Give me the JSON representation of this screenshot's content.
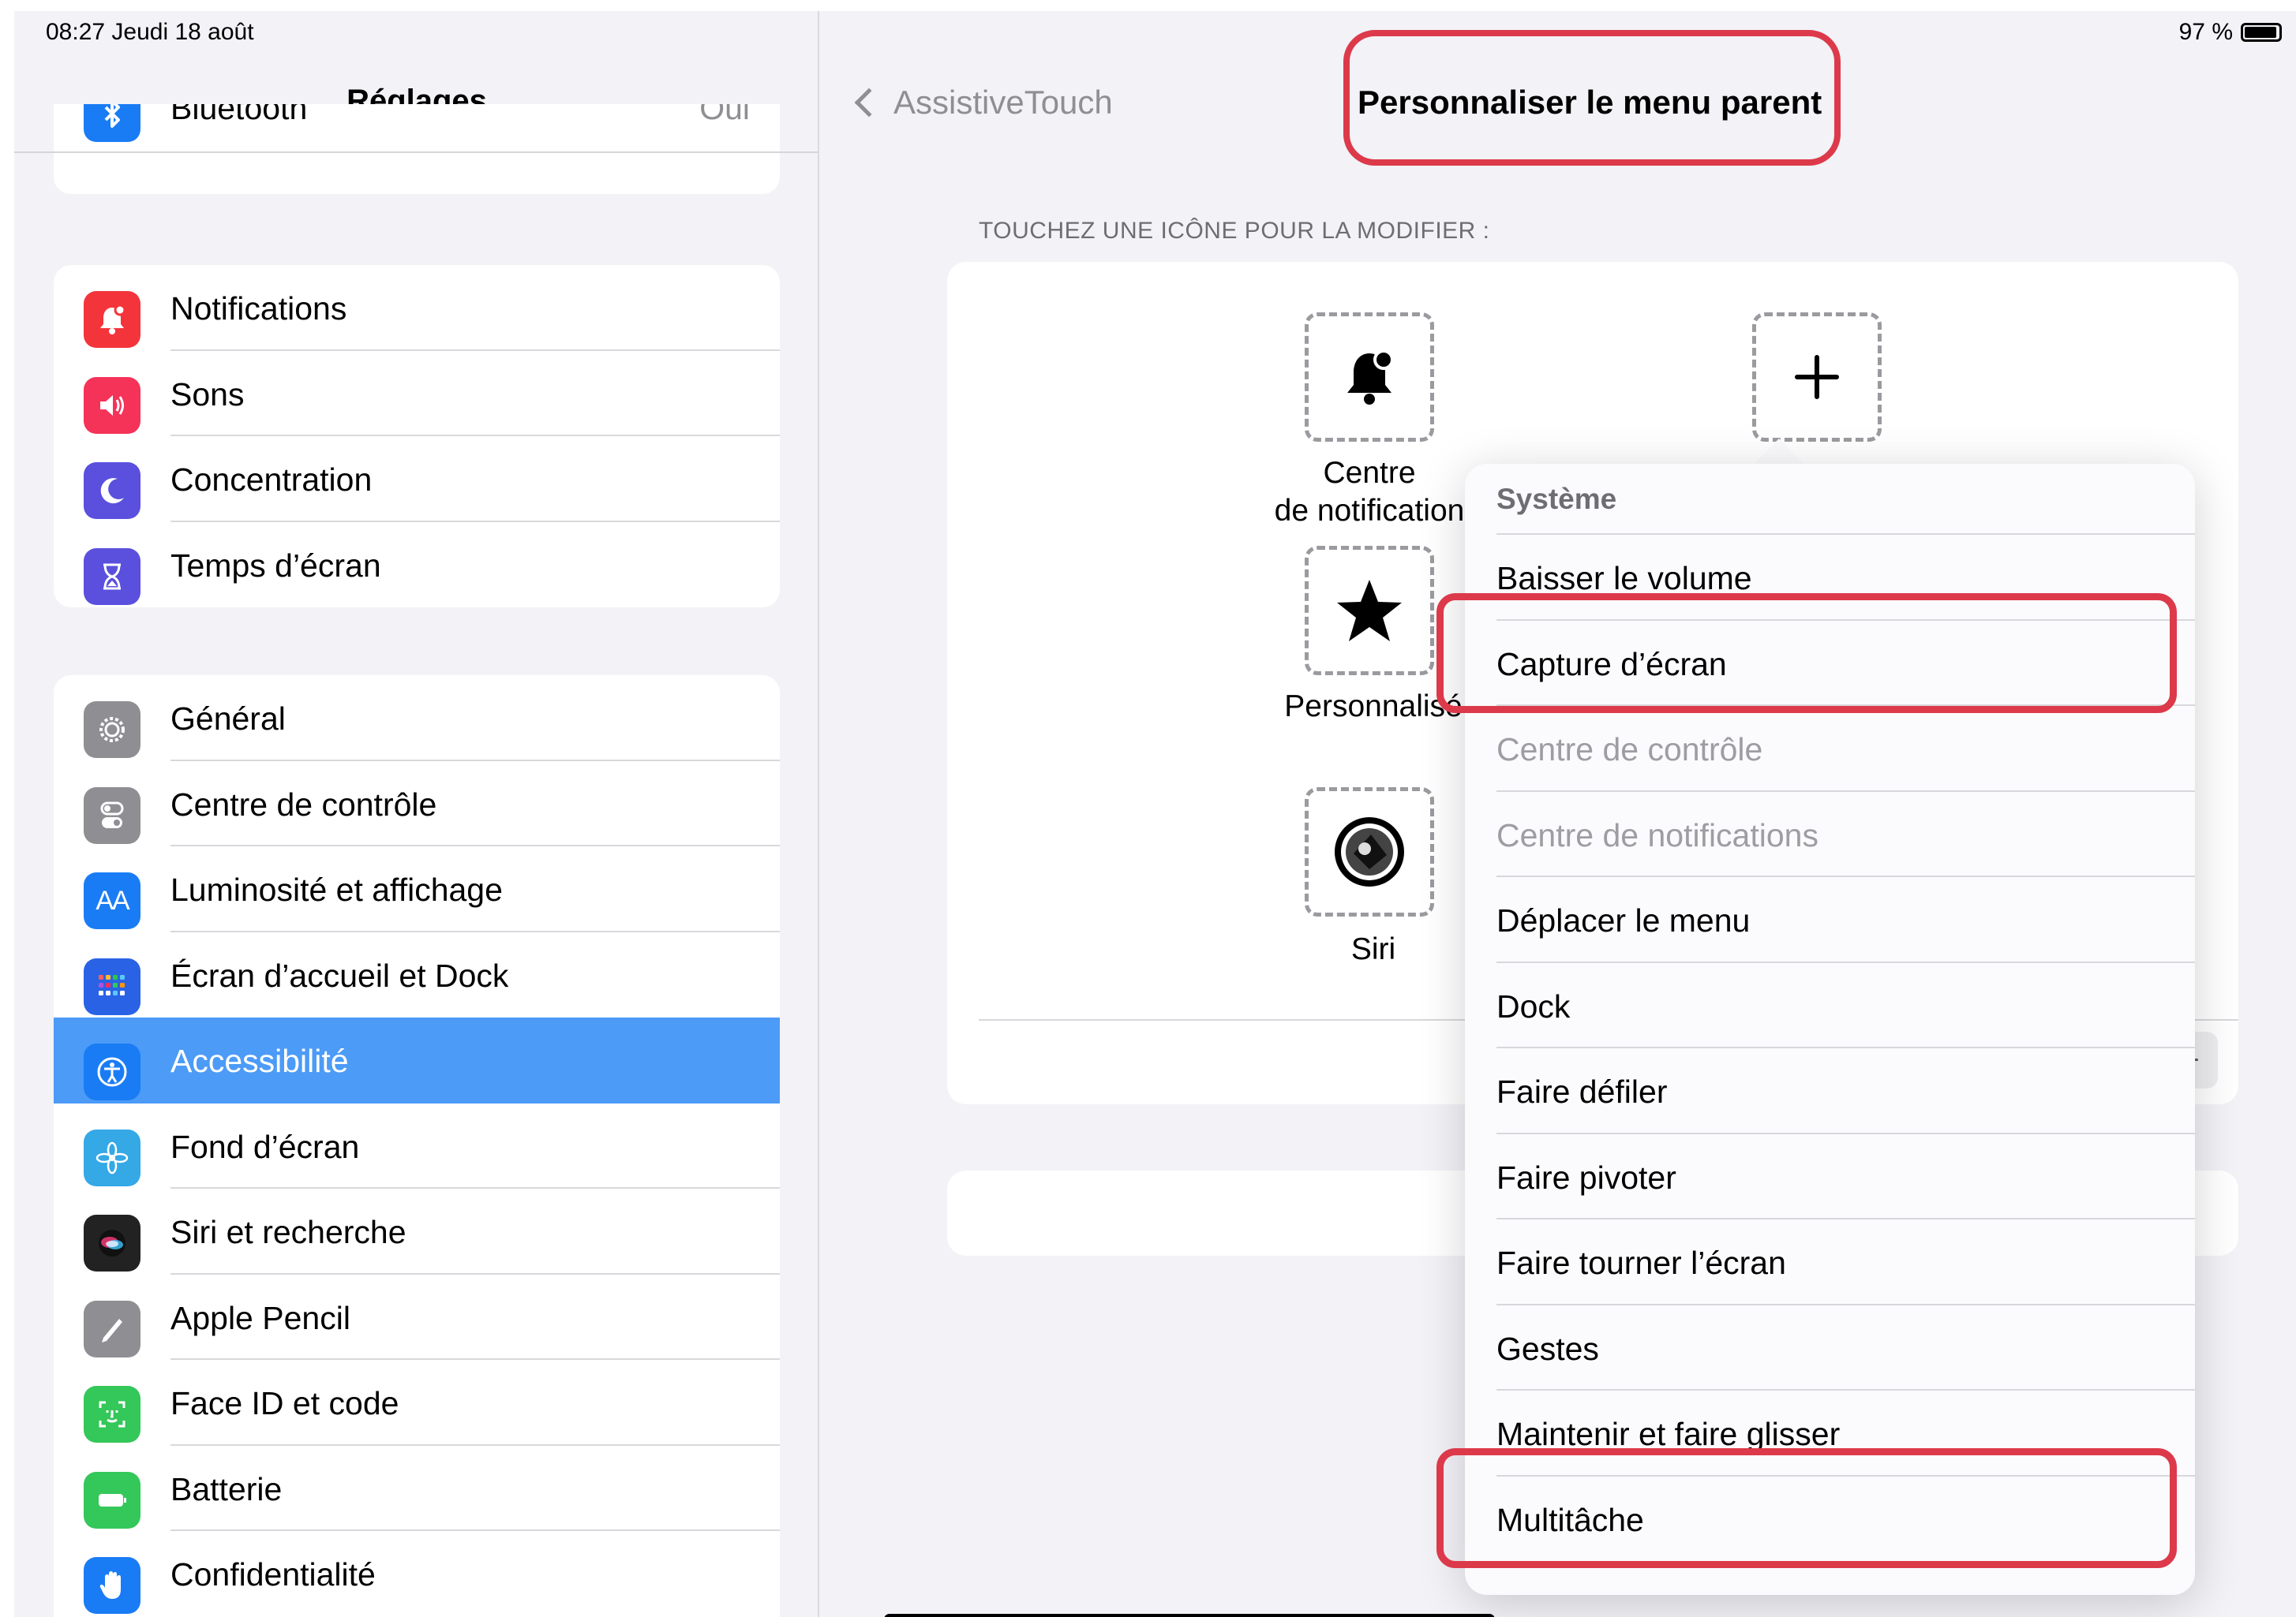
{
  "status": {
    "time_date": "08:27   Jeudi 18 août",
    "battery": "97 %"
  },
  "sidebar": {
    "title": "Réglages",
    "partial_row": {
      "label": "Bluetooth",
      "value": "Oui",
      "color": "#1a7cf5"
    },
    "group1": [
      {
        "label": "Notifications",
        "icon": "bell-badge-icon",
        "color": "#f4343b"
      },
      {
        "label": "Sons",
        "icon": "speaker-icon",
        "color": "#f53258"
      },
      {
        "label": "Concentration",
        "icon": "moon-icon",
        "color": "#5a50dd"
      },
      {
        "label": "Temps d’écran",
        "icon": "hourglass-icon",
        "color": "#5a50dd"
      }
    ],
    "group2": [
      {
        "label": "Général",
        "icon": "gear-icon",
        "color": "#8e8e93"
      },
      {
        "label": "Centre de contrôle",
        "icon": "toggles-icon",
        "color": "#8e8e93"
      },
      {
        "label": "Luminosité et affichage",
        "icon": "text-size-icon",
        "color": "#1a7cf5"
      },
      {
        "label": "Écran d’accueil et Dock",
        "icon": "home-grid-icon",
        "color": "#2a62e5"
      },
      {
        "label": "Accessibilité",
        "icon": "accessibility-icon",
        "color": "#1a7cf5",
        "selected": true
      },
      {
        "label": "Fond d’écran",
        "icon": "flower-icon",
        "color": "#35a8e6"
      },
      {
        "label": "Siri et recherche",
        "icon": "siri-icon",
        "color": "#222222"
      },
      {
        "label": "Apple Pencil",
        "icon": "pencil-icon",
        "color": "#8e8e93"
      },
      {
        "label": "Face ID et code",
        "icon": "face-id-icon",
        "color": "#34c759"
      },
      {
        "label": "Batterie",
        "icon": "battery-icon",
        "color": "#34c759"
      },
      {
        "label": "Confidentialité",
        "icon": "hand-icon",
        "color": "#1a7cf5"
      }
    ]
  },
  "detail": {
    "back_label": "AssistiveTouch",
    "title": "Personnaliser le menu parent",
    "section_caption": "TOUCHEZ UNE ICÔNE POUR LA MODIFIER :",
    "slots": [
      {
        "label": "Centre\nde notification",
        "icon": "bell-badge-icon"
      },
      {
        "label": "",
        "icon": "plus-icon"
      },
      {
        "label": "Personnalisé",
        "icon": "star-icon"
      },
      {
        "label": "Siri",
        "icon": "siri-button-icon"
      }
    ],
    "minus_label": "−"
  },
  "popover": {
    "header": "Système",
    "items": [
      {
        "label": "Baisser le volume"
      },
      {
        "label": "Capture d’écran",
        "highlighted": true
      },
      {
        "label": "Centre de contrôle",
        "disabled": true
      },
      {
        "label": "Centre de notifications",
        "disabled": true
      },
      {
        "label": "Déplacer le menu"
      },
      {
        "label": "Dock"
      },
      {
        "label": "Faire défiler"
      },
      {
        "label": "Faire pivoter"
      },
      {
        "label": "Faire tourner l’écran"
      },
      {
        "label": "Gestes"
      },
      {
        "label": "Maintenir et faire glisser"
      },
      {
        "label": "Multitâche",
        "highlighted": true
      }
    ]
  },
  "colors": {
    "highlight": "#dc3a4a",
    "selection": "#4c9bf7",
    "background": "#f2f2f7"
  }
}
